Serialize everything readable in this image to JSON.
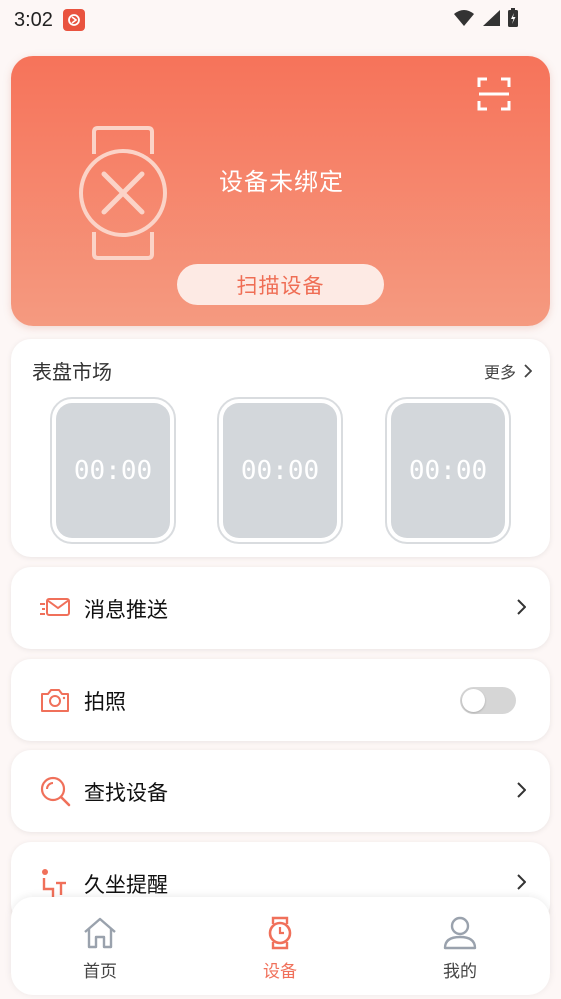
{
  "status_bar": {
    "time": "3:02"
  },
  "device_header": {
    "status": "设备未绑定",
    "scan_button": "扫描设备",
    "scan_icon": "qr-scan-icon",
    "watch_icon": "watch-unbound-icon"
  },
  "dial_market": {
    "title": "表盘市场",
    "more": "更多",
    "dials": [
      {
        "time": "00:00"
      },
      {
        "time": "00:00"
      },
      {
        "time": "00:00"
      }
    ]
  },
  "features": [
    {
      "label": "消息推送",
      "icon": "message-icon",
      "control": "chevron"
    },
    {
      "label": "拍照",
      "icon": "camera-icon",
      "control": "toggle",
      "enabled": false
    },
    {
      "label": "查找设备",
      "icon": "search-icon",
      "control": "chevron"
    },
    {
      "label": "久坐提醒",
      "icon": "sedentary-icon",
      "control": "chevron"
    }
  ],
  "bottom_nav": {
    "items": [
      {
        "label": "首页",
        "icon": "home-icon",
        "active": false
      },
      {
        "label": "设备",
        "icon": "watch-icon",
        "active": true
      },
      {
        "label": "我的",
        "icon": "profile-icon",
        "active": false
      }
    ]
  },
  "colors": {
    "accent": "#f0705a",
    "hero_top": "#f6735a",
    "hero_bottom": "#f59a80"
  }
}
